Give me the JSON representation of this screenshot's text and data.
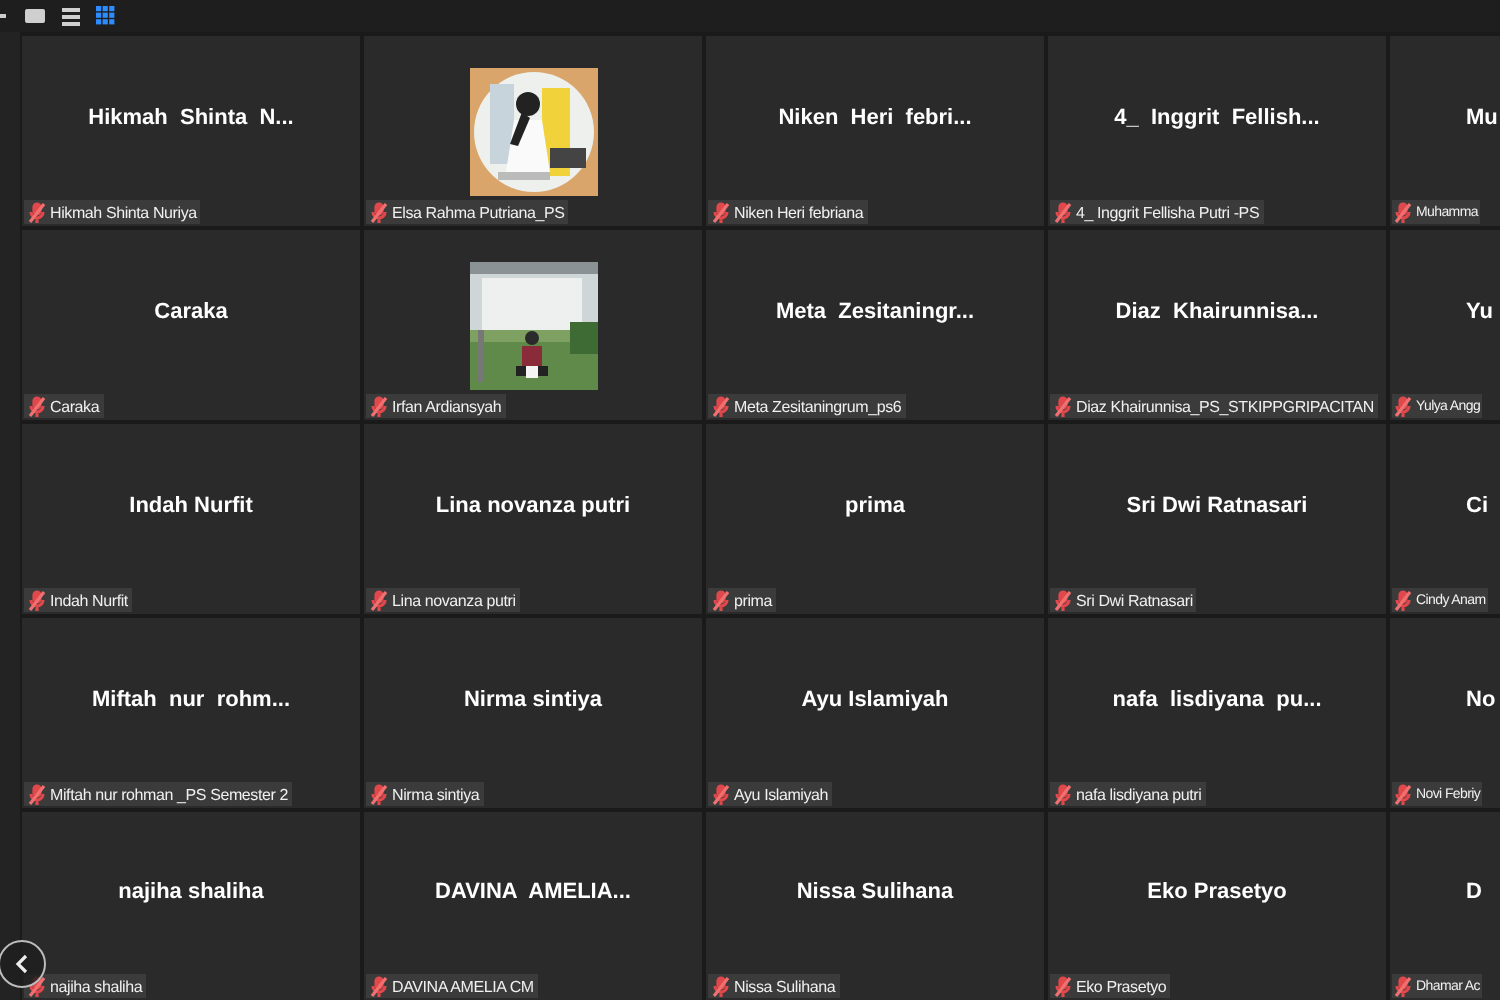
{
  "view_buttons": [
    {
      "kind": "speaker",
      "selected": false
    },
    {
      "kind": "stack",
      "selected": false
    },
    {
      "kind": "gallery",
      "selected": true
    }
  ],
  "tiles": [
    {
      "kind": "name",
      "display_name": "Hikmah  Shinta  N...",
      "label": "Hikmah Shinta Nuriya",
      "muted": true
    },
    {
      "kind": "picture",
      "label": "Elsa Rahma Putriana_PS",
      "muted": true
    },
    {
      "kind": "name",
      "display_name": "Niken  Heri  febri...",
      "label": "Niken Heri febriana",
      "muted": true
    },
    {
      "kind": "name",
      "display_name": "4_  Inggrit  Fellish...",
      "label": "4_ Inggrit Fellisha Putri -PS",
      "muted": true
    },
    {
      "kind": "cut",
      "display_name": "Mu",
      "label": "Muhamma",
      "muted": true
    },
    {
      "kind": "name",
      "display_name": "Caraka",
      "label": "Caraka",
      "muted": true
    },
    {
      "kind": "picture",
      "label": "Irfan Ardiansyah",
      "muted": true
    },
    {
      "kind": "name",
      "display_name": "Meta  Zesitaningr...",
      "label": "Meta Zesitaningrum_ps6",
      "muted": true
    },
    {
      "kind": "name",
      "display_name": "Diaz  Khairunnisa...",
      "label": "Diaz Khairunnisa_PS_STKIPPGRIPACITAN",
      "muted": true
    },
    {
      "kind": "cut",
      "display_name": "Yu",
      "label": "Yulya Angg",
      "muted": true
    },
    {
      "kind": "name",
      "display_name": "Indah Nurfit",
      "label": "Indah Nurfit",
      "muted": true
    },
    {
      "kind": "name",
      "display_name": "Lina novanza putri",
      "label": "Lina novanza putri",
      "muted": true
    },
    {
      "kind": "name",
      "display_name": "prima",
      "label": "prima",
      "muted": true
    },
    {
      "kind": "name",
      "display_name": "Sri Dwi Ratnasari",
      "label": "Sri Dwi Ratnasari",
      "muted": true
    },
    {
      "kind": "cut",
      "display_name": "Ci",
      "label": "Cindy Anam",
      "muted": true
    },
    {
      "kind": "name",
      "display_name": "Miftah  nur  rohm...",
      "label": "Miftah nur rohman _PS Semester 2",
      "muted": true
    },
    {
      "kind": "name",
      "display_name": "Nirma sintiya",
      "label": "Nirma sintiya",
      "muted": true
    },
    {
      "kind": "name",
      "display_name": "Ayu Islamiyah",
      "label": "Ayu Islamiyah",
      "muted": true
    },
    {
      "kind": "name",
      "display_name": "nafa  lisdiyana  pu...",
      "label": "nafa lisdiyana putri",
      "muted": true
    },
    {
      "kind": "cut",
      "display_name": "No",
      "label": "Novi Febriy",
      "muted": true
    },
    {
      "kind": "name",
      "display_name": "najiha shaliha",
      "label": "najiha shaliha",
      "muted": true
    },
    {
      "kind": "name",
      "display_name": "DAVINA  AMELIA...",
      "label": "DAVINA AMELIA CM",
      "muted": true
    },
    {
      "kind": "name",
      "display_name": "Nissa Sulihana",
      "label": "Nissa Sulihana",
      "muted": true
    },
    {
      "kind": "name",
      "display_name": "Eko Prasetyo",
      "label": "Eko Prasetyo",
      "muted": true
    },
    {
      "kind": "cut",
      "display_name": "D",
      "label": "Dhamar Ac",
      "muted": true
    }
  ]
}
